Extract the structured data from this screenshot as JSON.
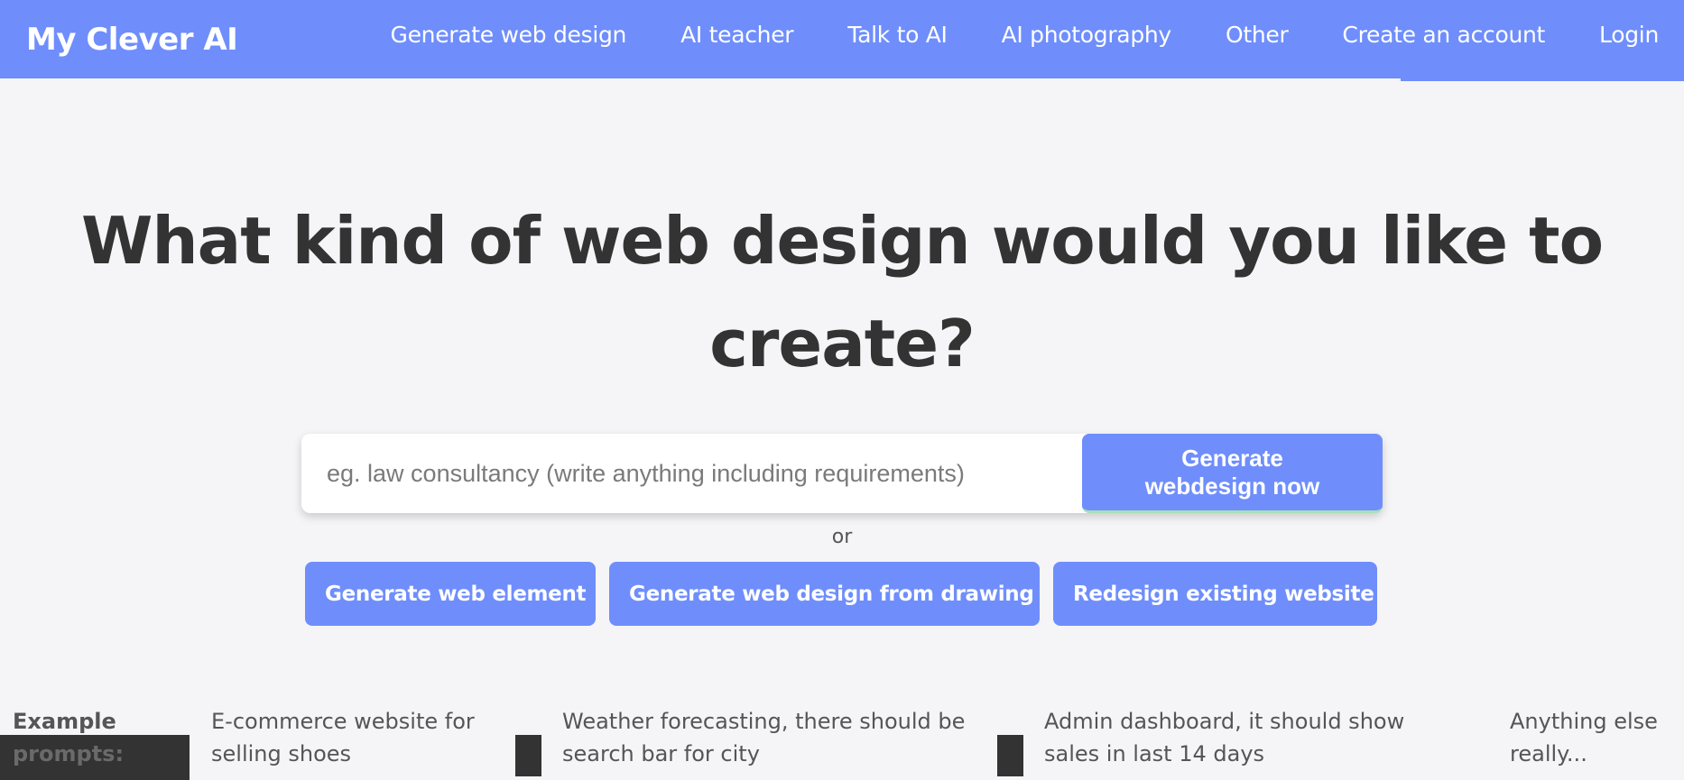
{
  "header": {
    "brand": "My Clever AI",
    "nav": [
      {
        "label": "Generate web design"
      },
      {
        "label": "AI teacher"
      },
      {
        "label": "Talk to AI"
      },
      {
        "label": "AI photography"
      },
      {
        "label": "Other"
      },
      {
        "label": "Create an account"
      },
      {
        "label": "Login"
      }
    ]
  },
  "hero": {
    "title": "What kind of web design would you like to create?"
  },
  "search": {
    "placeholder": "eg. law consultancy (write anything including requirements)",
    "button_line1": "Generate",
    "button_line2": "webdesign now"
  },
  "or_text": "or",
  "alt_buttons": [
    {
      "label": "Generate web element"
    },
    {
      "label": "Generate web design from drawing"
    },
    {
      "label": "Redesign existing website"
    }
  ],
  "examples": {
    "label_line1": "Example",
    "label_line2": "prompts:",
    "items": [
      {
        "line1": "E-commerce website for",
        "line2": "selling shoes"
      },
      {
        "line1": "Weather forecasting, there should be",
        "line2": "search bar for city"
      },
      {
        "line1": "Admin dashboard, it should show",
        "line2": "sales in last 14 days"
      },
      {
        "line1": "Anything else",
        "line2": "really..."
      }
    ]
  },
  "colors": {
    "accent": "#6f8efc",
    "background": "#f5f5f7",
    "text": "#333333"
  }
}
